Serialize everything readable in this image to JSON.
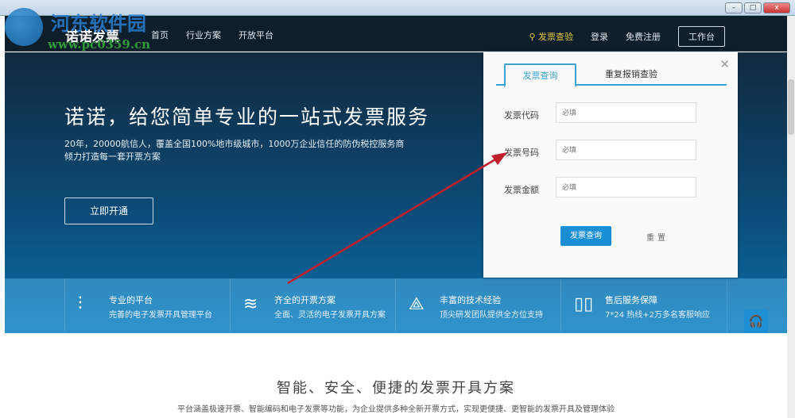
{
  "window": {
    "min": "–",
    "max": "□",
    "close": "x"
  },
  "watermark": {
    "name": "河东软件园",
    "url": "www.pc0359.cn"
  },
  "nav": {
    "brand": "诺诺发票",
    "links": [
      "首页",
      "行业方案",
      "开放平台"
    ],
    "query": "发票查验",
    "login": "登录",
    "register": "免费注册",
    "workbench": "工作台"
  },
  "hero": {
    "title": "诺诺，给您简单专业的一站式发票服务",
    "line1": "20年，20000航信人，覆盖全国100%地市级城市，1000万企业信任的防伪税控服务商",
    "line2": "倾力打造每一套开票方案",
    "button": "立即开通"
  },
  "features": [
    {
      "icon": "sliders-icon",
      "title": "专业的平台",
      "sub": "完善的电子发票开具管理平台"
    },
    {
      "icon": "layers-icon",
      "title": "齐全的开票方案",
      "sub": "全面、灵活的电子发票开具方案"
    },
    {
      "icon": "network-icon",
      "title": "丰富的技术经验",
      "sub": "顶尖研发团队提供全方位支持"
    },
    {
      "icon": "map-icon",
      "title": "售后服务保障",
      "sub": "7*24 热线+2万多名客服响应"
    }
  ],
  "section": {
    "title": "智能、安全、便捷的发票开具方案",
    "desc": "平台涵盖极速开票、智能编码和电子发票等功能，为企业提供多种全新开票方式，实现更便捷、更智能的发票开具及管理体验"
  },
  "panel": {
    "tabs": [
      "发票查询",
      "重复报销查验"
    ],
    "fields": [
      {
        "label": "发票代码",
        "placeholder": "必填"
      },
      {
        "label": "发票号码",
        "placeholder": "必填"
      },
      {
        "label": "发票金额",
        "placeholder": "必填"
      }
    ],
    "query_button": "发票查询",
    "reset_button": "重置"
  },
  "colors": {
    "accent": "#1a8fd5",
    "nav": "#0f1e2b",
    "query": "#e6c53a",
    "arrow": "#c0202a"
  }
}
